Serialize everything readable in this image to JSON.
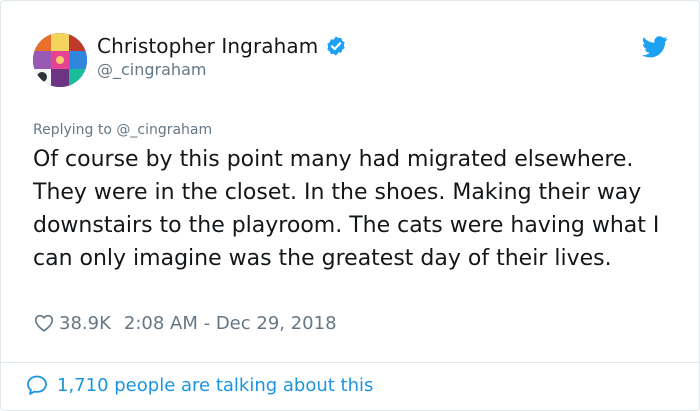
{
  "author": {
    "display_name": "Christopher Ingraham",
    "handle": "@_cingraham",
    "verified": true
  },
  "tweet": {
    "reply_label": "Replying to @_cingraham",
    "text": "Of course by this point many had migrated elsewhere. They were in the closet. In the shoes. Making their way downstairs to the playroom. The cats were having what I can only imagine was the greatest day of their lives.",
    "like_count": "38.9K",
    "timestamp": "2:08 AM - Dec 29, 2018"
  },
  "footer": {
    "talking_text": "1,710 people are talking about this"
  },
  "colors": {
    "twitter_blue": "#1da1f2",
    "link_blue": "#1b95e0",
    "secondary_text": "#657786",
    "border": "#e1e8ed"
  },
  "icons": {
    "verified": "verified-badge-icon",
    "bird": "twitter-bird-icon",
    "like": "heart-icon",
    "reply": "speech-bubble-icon"
  }
}
